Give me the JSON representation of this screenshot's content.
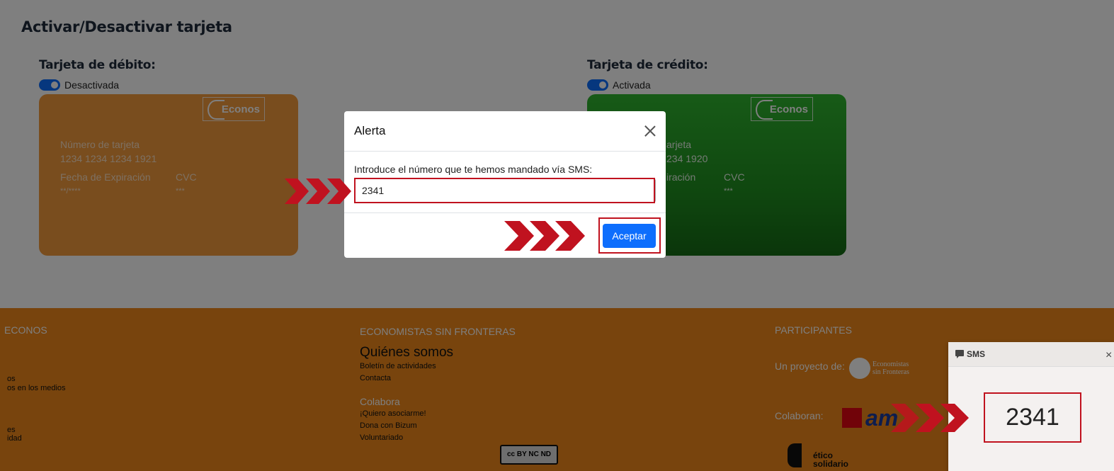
{
  "page": {
    "title": "Activar/Desactivar tarjeta"
  },
  "debit": {
    "heading": "Tarjeta de débito:",
    "status": "Desactivada",
    "brand": "Econos",
    "number_label": "Número de tarjeta",
    "number": "1234 1234 1234 1921",
    "exp_label": "Fecha de Expiración",
    "exp_value": "**/****",
    "cvc_label": "CVC",
    "cvc_value": "***"
  },
  "credit": {
    "heading": "Tarjeta de crédito:",
    "status": "Activada",
    "brand": "Econos",
    "number_label_partial": "arjeta",
    "number_partial": "234 1920",
    "exp_label_partial": "iración",
    "cvc_label": "CVC",
    "cvc_value": "***"
  },
  "modal": {
    "title": "Alerta",
    "prompt": "Introduce el número que te hemos mandado vía SMS:",
    "input_value": "2341",
    "accept_label": "Aceptar"
  },
  "footer": {
    "col1_heading": "ECONOS",
    "col1_links": [
      "os",
      "os en los medios",
      "es",
      "idad"
    ],
    "col2_heading": "ECONOMISTAS SIN FRONTERAS",
    "col2_title": "Quiénes somos",
    "col2_links": [
      "Boletín de actividades",
      "Contacta"
    ],
    "col2_sub": "Colabora",
    "col2_sub_links": [
      "¡Quiero asociarme!",
      "Dona con Bizum",
      "Voluntariado"
    ],
    "col3_heading": "PARTICIPANTES",
    "project_label": "Un proyecto de:",
    "esf_logo_text": [
      "Economistas",
      "sin Fronteras"
    ],
    "collab_label": "Colaboran:",
    "amx_text": "am",
    "etico_text": [
      "ético",
      "solidario"
    ],
    "cc_text": "cc BY NC ND"
  },
  "sms": {
    "header": "SMS",
    "close": "×",
    "code": "2341"
  },
  "colors": {
    "accent": "#0d6efd",
    "highlight": "#c0121f",
    "debit_card": "#f39a3c",
    "credit_card": "#2fb52f",
    "footer": "#f0881a"
  }
}
